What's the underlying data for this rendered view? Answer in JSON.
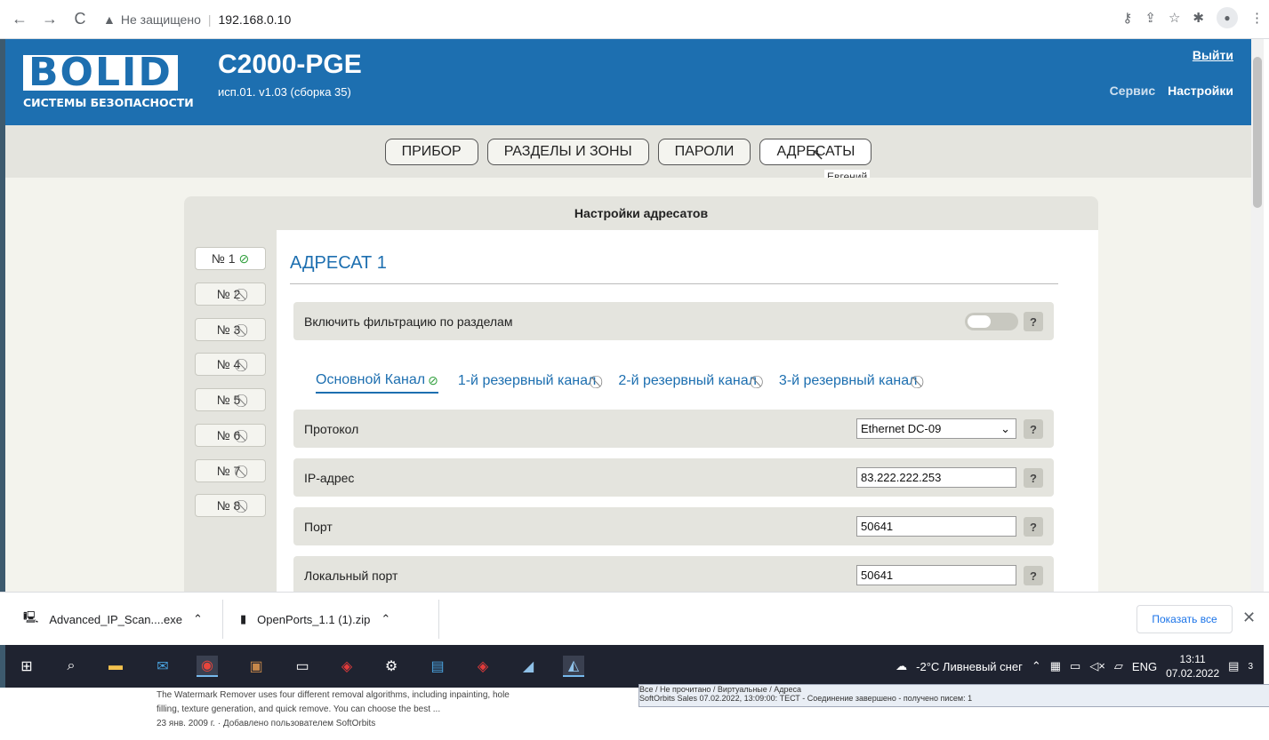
{
  "browser": {
    "security_label": "Не защищено",
    "url": "192.168.0.10"
  },
  "header": {
    "logo_word": "BOLID",
    "logo_sub": "СИСТЕМЫ БЕЗОПАСНОСТИ",
    "device_title": "C2000-PGE",
    "device_version": "исп.01. v1.03 (сборка 35)",
    "logout": "Выйти",
    "service": "Сервис",
    "settings": "Настройки"
  },
  "tabs": [
    {
      "label": "ПРИБОР"
    },
    {
      "label": "РАЗДЕЛЫ И ЗОНЫ"
    },
    {
      "label": "ПАРОЛИ"
    },
    {
      "label": "АДРЕСАТЫ"
    }
  ],
  "tooltip": "Евгений",
  "panel": {
    "title": "Настройки адресатов",
    "recipients": [
      {
        "label": "№ 1",
        "status": "ok"
      },
      {
        "label": "№ 2",
        "status": "off"
      },
      {
        "label": "№ 3",
        "status": "off"
      },
      {
        "label": "№ 4",
        "status": "off"
      },
      {
        "label": "№ 5",
        "status": "off"
      },
      {
        "label": "№ 6",
        "status": "off"
      },
      {
        "label": "№ 7",
        "status": "off"
      },
      {
        "label": "№ 8",
        "status": "off"
      }
    ],
    "recipient_title": "АДРЕСАТ 1",
    "filter_label": "Включить фильтрацию по разделам",
    "help": "?",
    "channels": [
      {
        "label": "Основной Канал",
        "status": "ok"
      },
      {
        "label": "1-й резервный канал",
        "status": "off"
      },
      {
        "label": "2-й резервный канал",
        "status": "off"
      },
      {
        "label": "3-й резервный канал",
        "status": "off"
      }
    ],
    "fields": {
      "protocol_label": "Протокол",
      "protocol_value": "Ethernet DC-09",
      "ip_label": "IP-адрес",
      "ip_value": "83.222.222.253",
      "port_label": "Порт",
      "port_value": "50641",
      "local_port_label": "Локальный порт",
      "local_port_value": "50641"
    }
  },
  "downloads": {
    "items": [
      {
        "name": "Advanced_IP_Scan....exe"
      },
      {
        "name": "OpenPorts_1.1 (1).zip"
      }
    ],
    "show_all": "Показать все"
  },
  "taskbar": {
    "weather": "-2°C  Ливневый снег",
    "lang": "ENG",
    "time": "13:11",
    "date": "07.02.2022",
    "notifications": "3"
  },
  "background": {
    "line1": "The Watermark Remover uses four different removal algorithms, including inpainting, hole",
    "line2": "filling, texture generation, and quick remove. You can choose the best ...",
    "line3": "23 янв. 2009 г. · Добавлено пользователем SoftOrbits",
    "win_line1": "Все / Не прочитано / Виртуальные / Адреса",
    "win_line2": "SoftOrbits Sales    07.02.2022, 13:09:00: ТЕСТ - Соединение завершено - получено писем: 1"
  }
}
